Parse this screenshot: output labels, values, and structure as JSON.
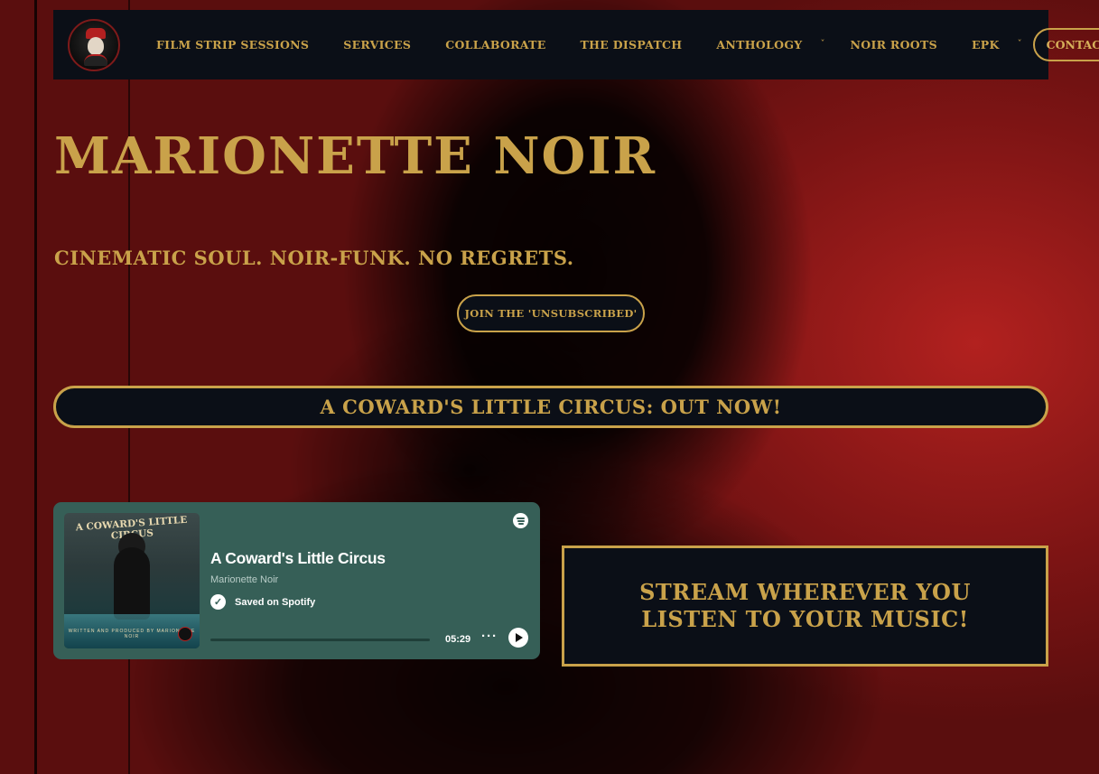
{
  "nav": {
    "logo_icon": "marionette-noir-logo",
    "items": [
      {
        "label": "FILM STRIP SESSIONS",
        "has_dropdown": false
      },
      {
        "label": "SERVICES",
        "has_dropdown": false
      },
      {
        "label": "COLLABORATE",
        "has_dropdown": false
      },
      {
        "label": "THE DISPATCH",
        "has_dropdown": false
      },
      {
        "label": "ANTHOLOGY",
        "has_dropdown": true
      },
      {
        "label": "NOIR ROOTS",
        "has_dropdown": false
      },
      {
        "label": "EPK",
        "has_dropdown": true
      }
    ],
    "caret_glyph": "ˇ",
    "contact_label": "CONTACT"
  },
  "hero": {
    "title": "MARIONETTE NOIR",
    "tagline": "CINEMATIC SOUL. NOIR-FUNK. NO REGRETS.",
    "join_label": "JOIN THE 'UNSUBSCRIBED'"
  },
  "banner": {
    "text": "A COWARD'S LITTLE CIRCUS: OUT NOW!"
  },
  "spotify_embed": {
    "album_art_text": "A COWARD'S LITTLE CIRCUS",
    "album_credit_text": "WRITTEN AND PRODUCED BY MARIONETTE NOIR",
    "track_title": "A Coward's Little Circus",
    "artist": "Marionette Noir",
    "saved_label": "Saved on Spotify",
    "duration": "05:29",
    "progress": 0,
    "more_glyph": "···",
    "check_glyph": "✓",
    "icons": {
      "brand": "spotify-icon",
      "saved": "checkmark-icon",
      "more": "more-options-icon",
      "play": "play-icon"
    }
  },
  "stream": {
    "text": "STREAM WHEREVER YOU LISTEN TO YOUR MUSIC!"
  },
  "colors": {
    "accent_gold": "#c9a24a",
    "nav_bg": "#0b0f17",
    "spotify_card": "#365f57",
    "background_red": "#8f1818"
  }
}
